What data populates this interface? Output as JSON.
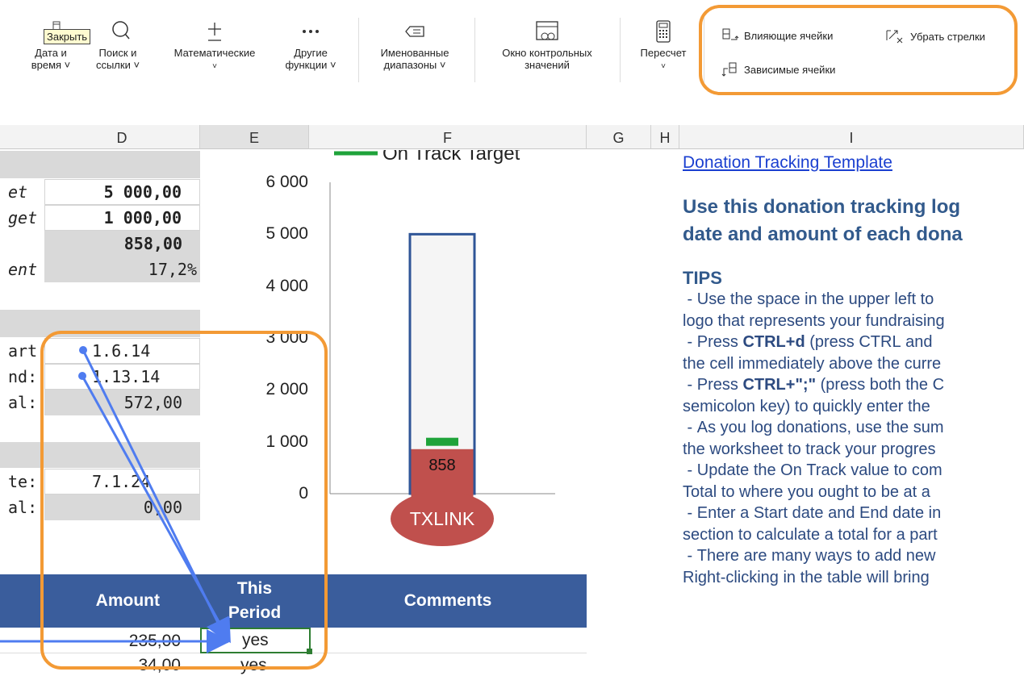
{
  "ribbon": {
    "tooltip": "Закрыть",
    "buttons": [
      {
        "label1": "Дата и",
        "label2": "время ˅",
        "icon": "calendar-icon"
      },
      {
        "label1": "Поиск и",
        "label2": "ссылки ˅",
        "icon": "search-icon"
      },
      {
        "label1": "Математические",
        "label2": "˅",
        "icon": "math-icon"
      },
      {
        "label1": "Другие",
        "label2": "функции ˅",
        "icon": "more-icon"
      },
      {
        "label1": "Именованные",
        "label2": "диапазоны ˅",
        "icon": "name-tag-icon"
      },
      {
        "label1": "Окно контрольных",
        "label2": "значений",
        "icon": "watch-window-icon"
      },
      {
        "label1": "Пересчет",
        "label2": "˅",
        "icon": "calculator-icon"
      }
    ],
    "audit": {
      "precedents": "Влияющие ячейки",
      "remove_arrows": "Убрать стрелки",
      "dependents": "Зависимые ячейки"
    }
  },
  "columns": [
    "D",
    "E",
    "F",
    "G",
    "H",
    "I"
  ],
  "cells": {
    "target_lbl": "et",
    "target_val": "5 000,00",
    "ontrack_lbl": "get",
    "ontrack_val": "1 000,00",
    "total_val": "858,00",
    "percent_lbl": "ent",
    "percent_val": "17,2%",
    "start_lbl": "art:",
    "start_val": "1.6.14",
    "end_lbl": "nd:",
    "end_val": "1.13.14",
    "period_total_lbl": "al:",
    "period_total_val": "572,00",
    "date_lbl": "te:",
    "date_val": "7.1.24",
    "date_total_lbl": "al:",
    "date_total_val": "0,00"
  },
  "chart_data": {
    "type": "bar",
    "legend": [
      "On Track Target"
    ],
    "yticks": [
      "6 000",
      "5 000",
      "4 000",
      "3 000",
      "2 000",
      "1 000",
      "0"
    ],
    "ylim": [
      0,
      6000
    ],
    "goal": 5000,
    "value": 858,
    "value_label": "858",
    "on_track": 1000,
    "bulb_label": "TXLINK",
    "colors": {
      "fill": "#c0504d",
      "outline": "#2f5597",
      "target": "#1fa33a"
    }
  },
  "notes": {
    "link": "Donation Tracking Template",
    "heading1": "Use this donation tracking log",
    "heading2": "date and amount of each dona",
    "tips_title": "TIPS",
    "tips": [
      " - Use the space in the upper left to",
      "logo that represents your fundraising",
      " - Press CTRL+d (press CTRL and",
      "the cell immediately above the curre",
      " - Press CTRL+\";\" (press both the C",
      "semicolon key) to quickly enter the",
      " - As you log donations, use the sum",
      "the worksheet to track your progres",
      " - Update the On Track value to com",
      "Total to where you ought to be at a",
      " - Enter a Start date and End date in",
      "section to calculate a total for a part",
      " - There are many ways to add new",
      "Right-clicking in the table will bring"
    ]
  },
  "table": {
    "headers": {
      "amount": "Amount",
      "period1": "This",
      "period2": "Period",
      "comments": "Comments"
    },
    "rows": [
      {
        "amount": "235,00",
        "period": "yes"
      },
      {
        "amount": "34,00",
        "period": "yes"
      }
    ]
  }
}
